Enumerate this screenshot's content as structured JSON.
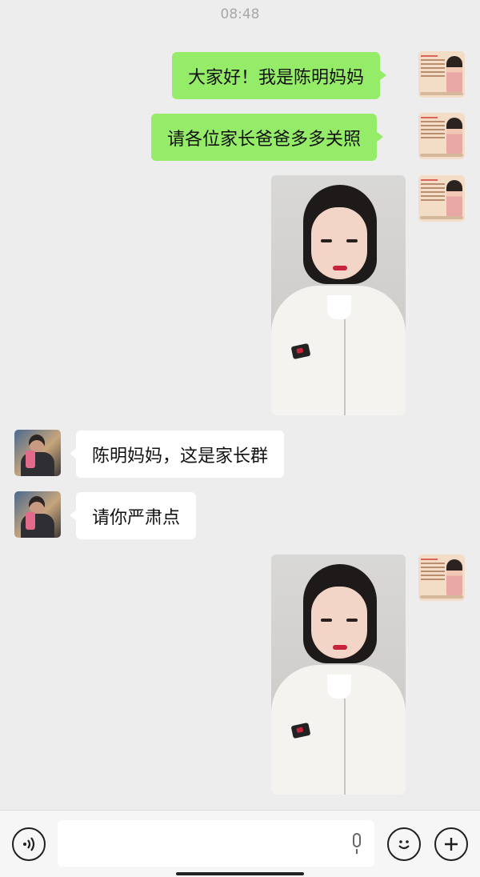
{
  "status": {
    "time": "08:48"
  },
  "messages": [
    {
      "sender": "self",
      "type": "text",
      "text": "大家好！我是陈明妈妈"
    },
    {
      "sender": "self",
      "type": "text",
      "text": "请各位家长爸爸多多关照"
    },
    {
      "sender": "self",
      "type": "image"
    },
    {
      "sender": "other",
      "type": "text",
      "text": "陈明妈妈，这是家长群"
    },
    {
      "sender": "other",
      "type": "text",
      "text": "请你严肃点"
    },
    {
      "sender": "self",
      "type": "image"
    }
  ],
  "input_bar": {
    "voice_icon": "voice-icon",
    "mic_icon": "microphone-icon",
    "emoji_icon": "emoji-icon",
    "plus_icon": "plus-icon"
  }
}
